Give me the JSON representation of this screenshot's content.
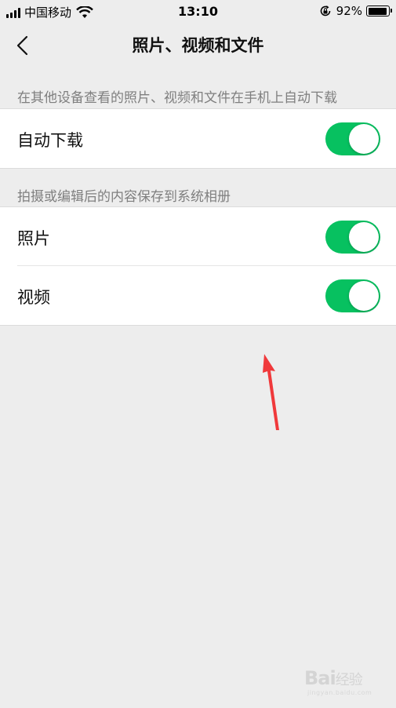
{
  "status_bar": {
    "carrier": "中国移动",
    "time": "13:10",
    "battery_percent": "92%",
    "battery_level": 0.92,
    "icons": [
      "signal-icon",
      "wifi-icon",
      "rotation-lock-icon",
      "battery-icon"
    ]
  },
  "nav": {
    "title": "照片、视频和文件",
    "back_icon": "chevron-left-icon"
  },
  "sections": [
    {
      "header": "在其他设备查看的照片、视频和文件在手机上自动下载",
      "items": [
        {
          "label": "自动下载",
          "enabled": true
        }
      ]
    },
    {
      "header": "拍摄或编辑后的内容保存到系统相册",
      "items": [
        {
          "label": "照片",
          "enabled": true
        },
        {
          "label": "视频",
          "enabled": true
        }
      ]
    }
  ],
  "annotation": {
    "icon": "red-arrow-icon",
    "color": "#f0393b"
  },
  "watermark": {
    "brand": "Bai",
    "brand_cn": "经验",
    "url": "jingyan.baidu.com"
  },
  "colors": {
    "toggle_on": "#07c160",
    "background": "#ededed",
    "section_text": "#7f7f7f"
  }
}
